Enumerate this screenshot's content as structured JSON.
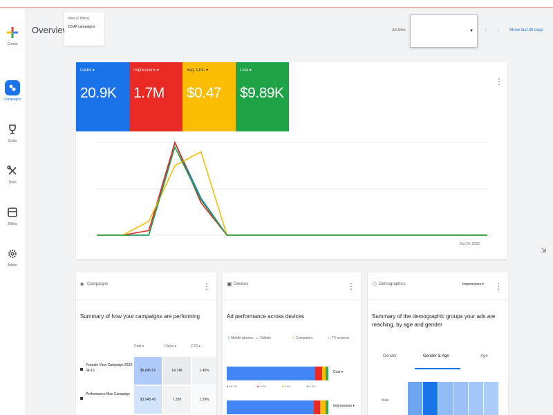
{
  "nav": {
    "items": [
      {
        "label": "Create"
      },
      {
        "label": "Campaigns"
      },
      {
        "label": "Goals"
      },
      {
        "label": "Tools"
      },
      {
        "label": "Billing"
      },
      {
        "label": "Admin"
      }
    ]
  },
  "header": {
    "title": "Overview",
    "scope_line1": "View (2 filters)",
    "scope_line2": "2/3 All campaigns",
    "filter_label": "All time",
    "filter_value": "",
    "show_last": "Show last 30 days"
  },
  "metrics": [
    {
      "label": "Clicks ▾",
      "value": "20.9K",
      "color": "#1a73e8"
    },
    {
      "label": "Impressions ▾",
      "value": "1.7M",
      "color": "#ea2a25"
    },
    {
      "label": "Avg. CPC ▾",
      "value": "$0.47",
      "color": "#fbbc04"
    },
    {
      "label": "Cost ▾",
      "value": "$9.89K",
      "color": "#1ea446"
    }
  ],
  "chart_data": {
    "type": "line",
    "x": [
      0,
      1,
      2,
      3,
      4,
      5,
      6,
      7,
      8,
      9,
      10,
      11,
      12,
      13,
      14,
      15
    ],
    "series": [
      {
        "color": "#1a73e8",
        "values": [
          0,
          0,
          0,
          100,
          40,
          0,
          0,
          0,
          0,
          0,
          0,
          0,
          0,
          0,
          0,
          0
        ]
      },
      {
        "color": "#ea2a25",
        "values": [
          0,
          0,
          5,
          100,
          35,
          0,
          0,
          0,
          0,
          0,
          0,
          0,
          0,
          0,
          0,
          0
        ]
      },
      {
        "color": "#fbbc04",
        "values": [
          0,
          0,
          15,
          75,
          90,
          0,
          0,
          0,
          0,
          0,
          0,
          0,
          0,
          0,
          0,
          0
        ]
      },
      {
        "color": "#1ea446",
        "values": [
          0,
          0,
          0,
          95,
          38,
          0,
          0,
          0,
          0,
          0,
          0,
          0,
          0,
          0,
          0,
          0
        ]
      }
    ],
    "ylim": [
      0,
      100
    ],
    "grid": true,
    "date_label": "Oct 24, 2023"
  },
  "campaigns_card": {
    "title": "Campaigns",
    "desc": "Summary of how your campaigns are performing",
    "columns": [
      "Cost ▾",
      "Clicks ▾",
      "CTR ▾"
    ],
    "rows": [
      {
        "name": "Youtube View Campaign 2023-04-15",
        "cost": "$5,845.52",
        "clicks": "14,748",
        "ctr": "1.45%"
      },
      {
        "name": "Performance Max Campaign",
        "cost": "$3,945.45",
        "clicks": "7,336",
        "ctr": "1.29%"
      }
    ]
  },
  "devices_card": {
    "title": "Devices",
    "desc": "Ad performance across devices",
    "legend": [
      "Mobile phones",
      "Tablets",
      "Computers",
      "TV screens"
    ],
    "bars": [
      {
        "caption": "Cost ▾",
        "segments": [
          87,
          7,
          3,
          3
        ],
        "pcts": [
          "86.7%",
          "7.3%",
          "3.4%",
          "2.6%"
        ]
      },
      {
        "caption": "Impressions ▾",
        "segments": [
          86,
          6,
          5,
          3
        ],
        "pcts": []
      }
    ],
    "colors": [
      "#4285f4",
      "#ea2a25",
      "#fbbc04",
      "#34a853"
    ]
  },
  "demographics_card": {
    "title": "Demographics",
    "metric": "Impressions ▾",
    "desc": "Summary of the demographic groups your ads are reaching, by age and gender",
    "tabs": [
      "Gender",
      "Gender & Age",
      "Age"
    ],
    "row_label": "Male",
    "heat": [
      0.55,
      1.0,
      0.35,
      0.3,
      0.25,
      0.2
    ]
  }
}
